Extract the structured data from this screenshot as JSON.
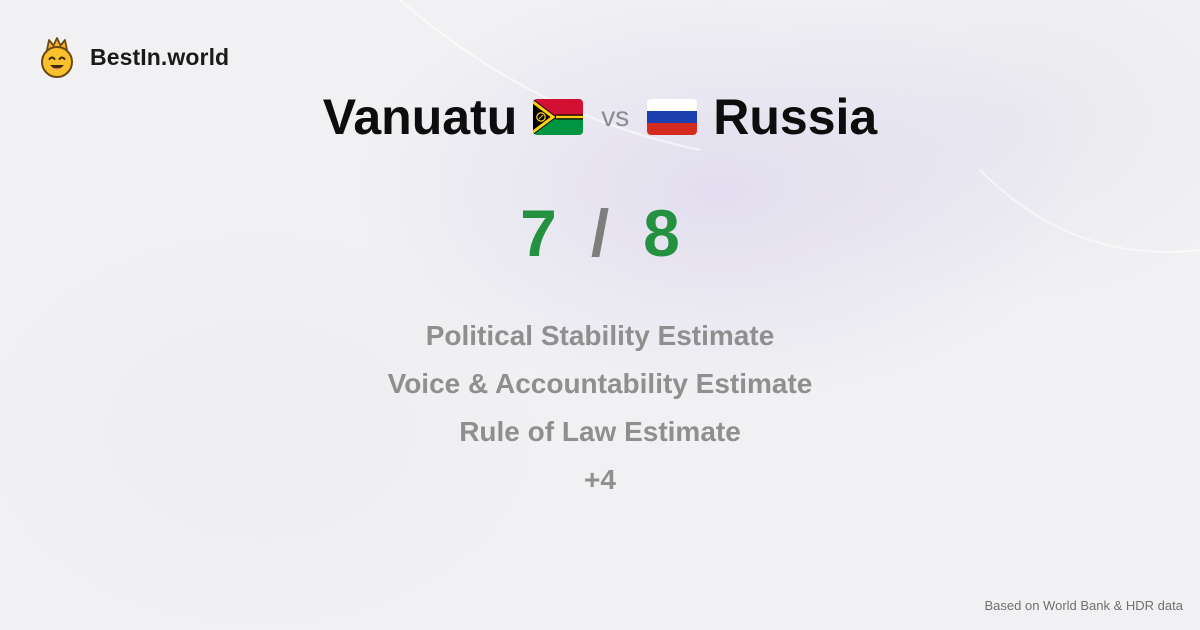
{
  "brand": {
    "name": "BestIn.world",
    "logo_icon": "crowned-smiley-icon"
  },
  "comparison": {
    "left_country": "Vanuatu",
    "left_flag_icon": "vanuatu-flag-icon",
    "vs_label": "vs",
    "right_country": "Russia",
    "right_flag_icon": "russia-flag-icon"
  },
  "score": {
    "left": "7",
    "separator": "/",
    "right": "8"
  },
  "metrics": [
    "Political Stability Estimate",
    "Voice & Accountability Estimate",
    "Rule of Law Estimate",
    "+4"
  ],
  "footnote": "Based on World Bank & HDR data",
  "colors": {
    "score": "#23913f",
    "muted": "#8f8f8f",
    "heading": "#0d0d0d",
    "background": "#f1f1f3"
  }
}
